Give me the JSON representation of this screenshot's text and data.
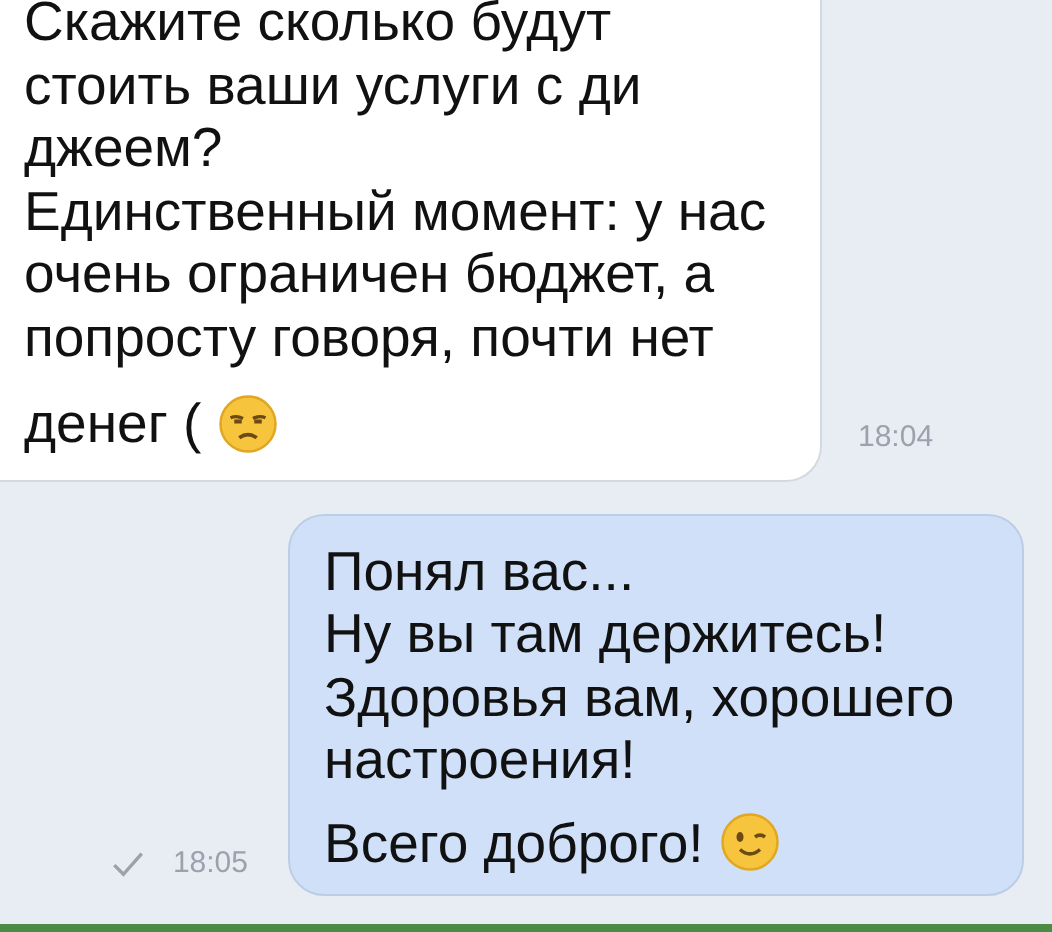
{
  "messages": [
    {
      "kind": "incoming",
      "lines": [
        "Скажите сколько будут",
        "стоить ваши услуги с ди",
        "джеем?",
        "Единственный момент: у нас",
        "очень ограничен бюджет, а",
        "попросту говоря, почти нет",
        "денег ("
      ],
      "emoji": {
        "kind": "unamused"
      },
      "time": "18:04"
    },
    {
      "kind": "outgoing",
      "lines": [
        "Понял вас...",
        "Ну вы там держитесь!",
        "Здоровья вам, хорошего",
        "настроения!",
        "Всего доброго!"
      ],
      "emoji": {
        "kind": "wink"
      },
      "time": "18:05",
      "read": true
    }
  ]
}
